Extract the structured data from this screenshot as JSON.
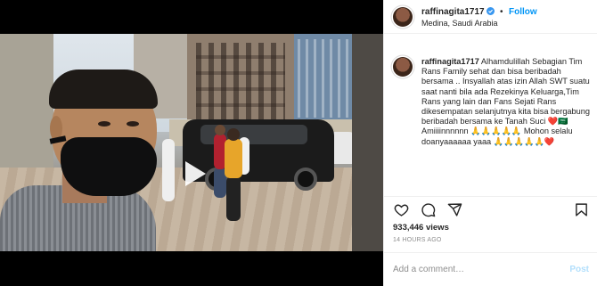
{
  "post": {
    "username": "raffinagita1717",
    "verified": true,
    "separator": "•",
    "follow_label": "Follow",
    "location": "Medina, Saudi Arabia"
  },
  "caption": {
    "username": "raffinagita1717",
    "text": "Alhamdulillah Sebagian Tim Rans Family sehat dan bisa beribadah bersama .. Insyallah atas izin Allah SWT suatu saat nanti bila ada Rezekinya Keluarga,Tim Rans yang lain dan Fans Sejati Rans dikesempatan selanjutnya kita bisa bergabung beribadah bersama ke Tanah Suci ❤️🇸🇦 Amiiiinnnnnn 🙏🙏🙏🙏🙏 Mohon selalu doanyaaaaaa yaaa 🙏🙏🙏🙏🙏❤️"
  },
  "stats": {
    "views": "933,446 views",
    "time_ago": "14 HOURS AGO"
  },
  "comment": {
    "placeholder": "Add a comment…",
    "post_label": "Post"
  },
  "icons": {
    "like": "heart-icon",
    "comment": "comment-icon",
    "share": "share-icon",
    "save": "bookmark-icon",
    "play": "play-icon",
    "verified": "verified-badge-icon"
  },
  "colors": {
    "accent": "#0095f6",
    "verified": "#3897f0",
    "post_disabled": "#b2dffc",
    "muted": "#8e8e8e"
  }
}
